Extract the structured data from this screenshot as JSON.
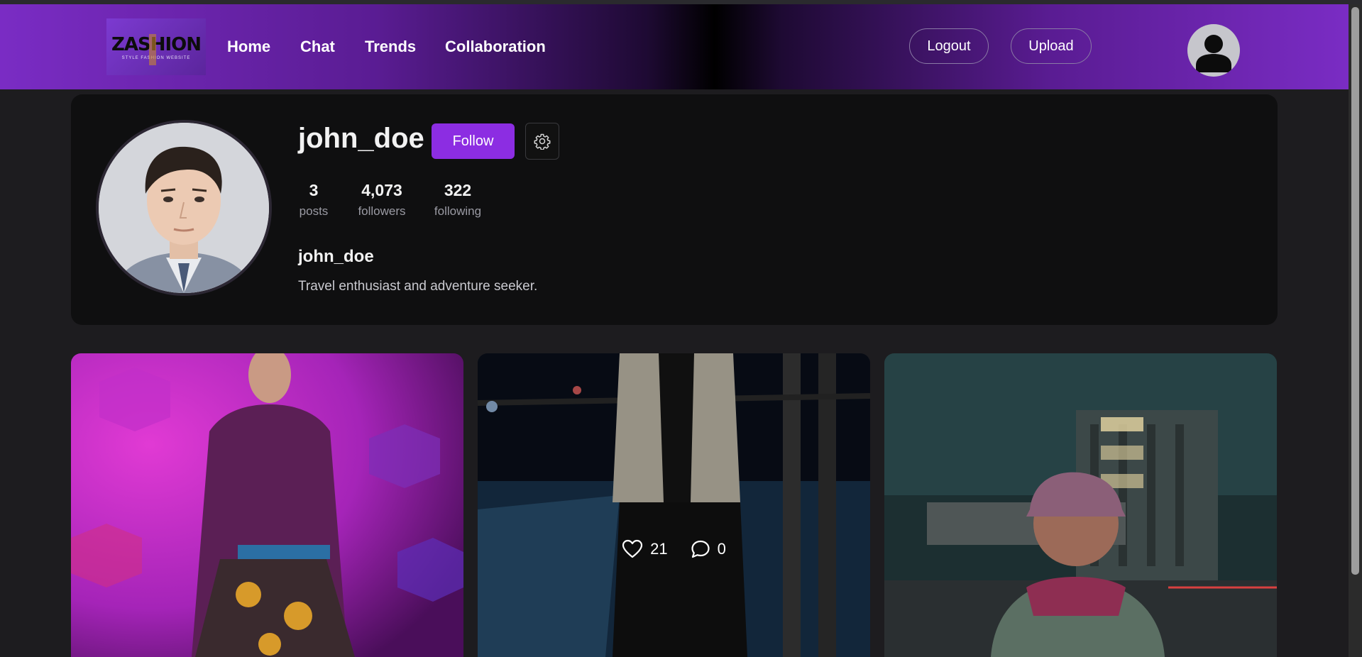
{
  "app": {
    "logo_text": "ZASHION",
    "logo_subtext": "STYLE  FASHION  WEBSITE"
  },
  "nav": {
    "links": [
      {
        "label": "Home"
      },
      {
        "label": "Chat"
      },
      {
        "label": "Trends"
      },
      {
        "label": "Collaboration"
      }
    ],
    "logout_label": "Logout",
    "upload_label": "Upload",
    "avatar_icon": "user-icon"
  },
  "profile": {
    "username": "john_doe",
    "follow_label": "Follow",
    "settings_icon": "gear-icon",
    "stats": [
      {
        "value": "3",
        "label": "posts"
      },
      {
        "value": "4,073",
        "label": "followers"
      },
      {
        "value": "322",
        "label": "following"
      }
    ],
    "display_name": "john_doe",
    "bio": "Travel enthusiast and adventure seeker."
  },
  "posts": [
    {
      "likes": "",
      "comments": "",
      "hovered": false
    },
    {
      "likes": "21",
      "comments": "0",
      "hovered": true
    },
    {
      "likes": "",
      "comments": "",
      "hovered": false
    }
  ],
  "colors": {
    "accent": "#8c2de2",
    "nav_purple": "#7a2cc4",
    "background": "#1d1c1f",
    "card": "#0f0f10"
  }
}
